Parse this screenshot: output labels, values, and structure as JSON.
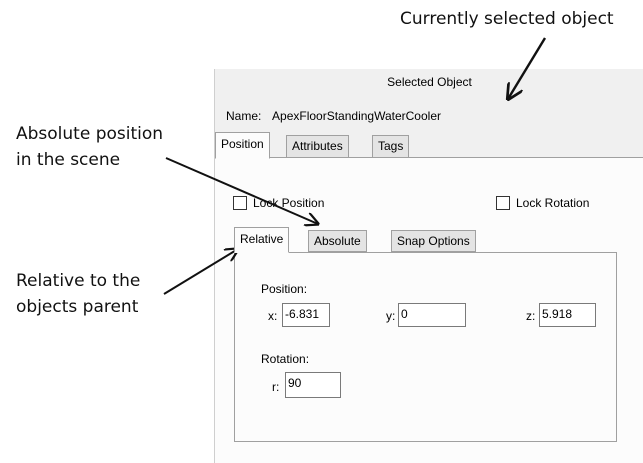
{
  "callouts": {
    "selected_object": "Currently selected object",
    "absolute_line1": "Absolute position",
    "absolute_line2": "in the scene",
    "relative_line1": "Relative to the",
    "relative_line2": "objects parent"
  },
  "panel": {
    "title": "Selected Object",
    "name_label": "Name:",
    "name_value": "ApexFloorStandingWaterCooler",
    "tabs": [
      "Position",
      "Attributes",
      "Tags"
    ],
    "lock_position": "Lock Position",
    "lock_rotation": "Lock Rotation",
    "sub_tabs": [
      "Relative",
      "Absolute",
      "Snap Options"
    ],
    "position_label": "Position:",
    "x_label": "x:",
    "x_value": "-6.831",
    "y_label": "y:",
    "y_value": "0",
    "z_label": "z:",
    "z_value": "5.918",
    "rotation_label": "Rotation:",
    "r_label": "r:",
    "r_value": "90"
  }
}
